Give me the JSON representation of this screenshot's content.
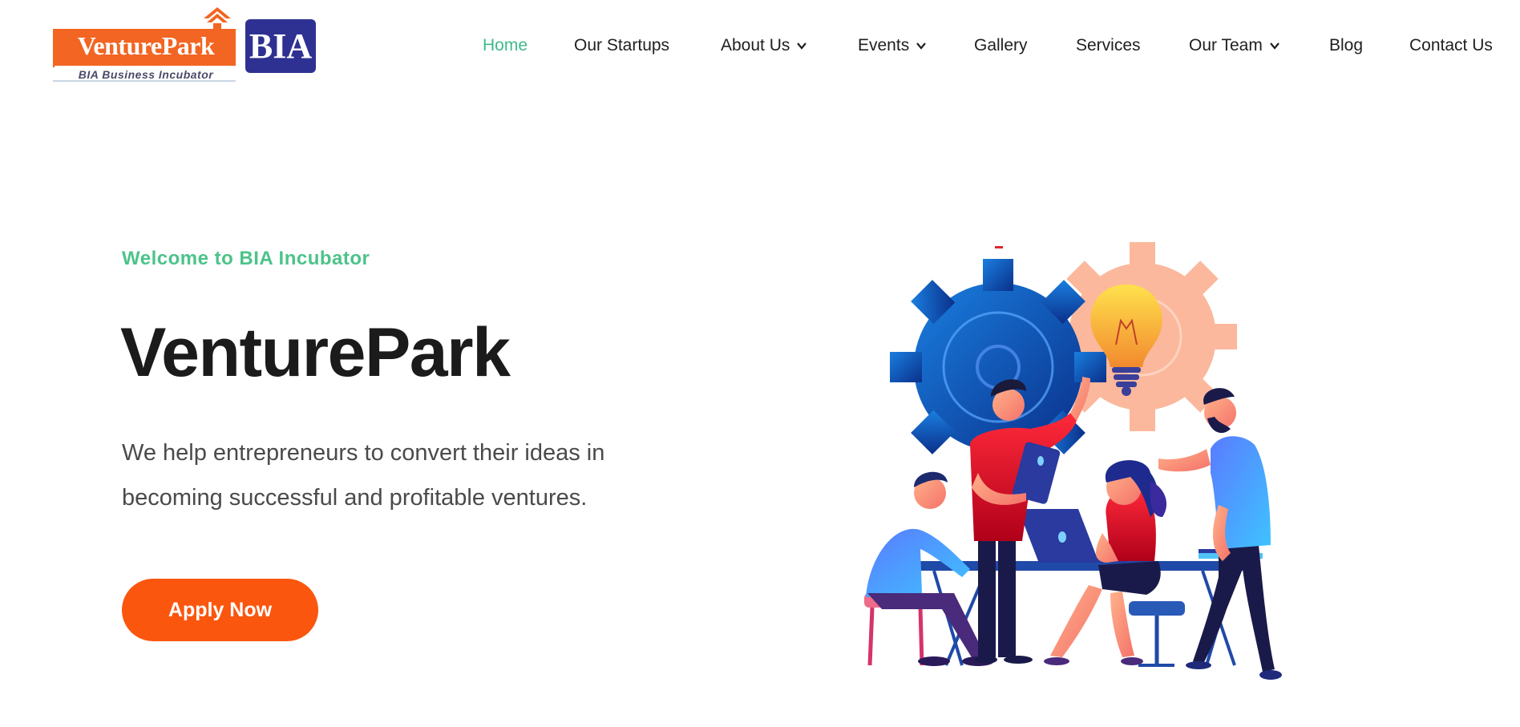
{
  "brand": {
    "logo_main": "VenturePark",
    "logo_sub": "BIA Business Incubator",
    "logo_badge": "BIA",
    "colors": {
      "orange": "#f26522",
      "navy": "#2e3192"
    }
  },
  "nav": {
    "items": [
      {
        "label": "Home",
        "active": true
      },
      {
        "label": "Our Startups"
      },
      {
        "label": "About Us",
        "dropdown": true
      },
      {
        "label": "Events",
        "dropdown": true
      },
      {
        "label": "Gallery"
      },
      {
        "label": "Services"
      },
      {
        "label": "Our Team",
        "dropdown": true
      },
      {
        "label": "Blog"
      },
      {
        "label": "Contact Us"
      }
    ],
    "active_color": "#3dbb8a"
  },
  "hero": {
    "eyebrow": "Welcome to BIA Incubator",
    "title": "VenturePark",
    "description_line1": "We help entrepreneurs to convert their ideas in",
    "description_line2": "becoming successful and profitable ventures.",
    "cta_label": "Apply Now",
    "cta_color": "#fb560e",
    "illustration": "team-collaboration-illustration"
  }
}
